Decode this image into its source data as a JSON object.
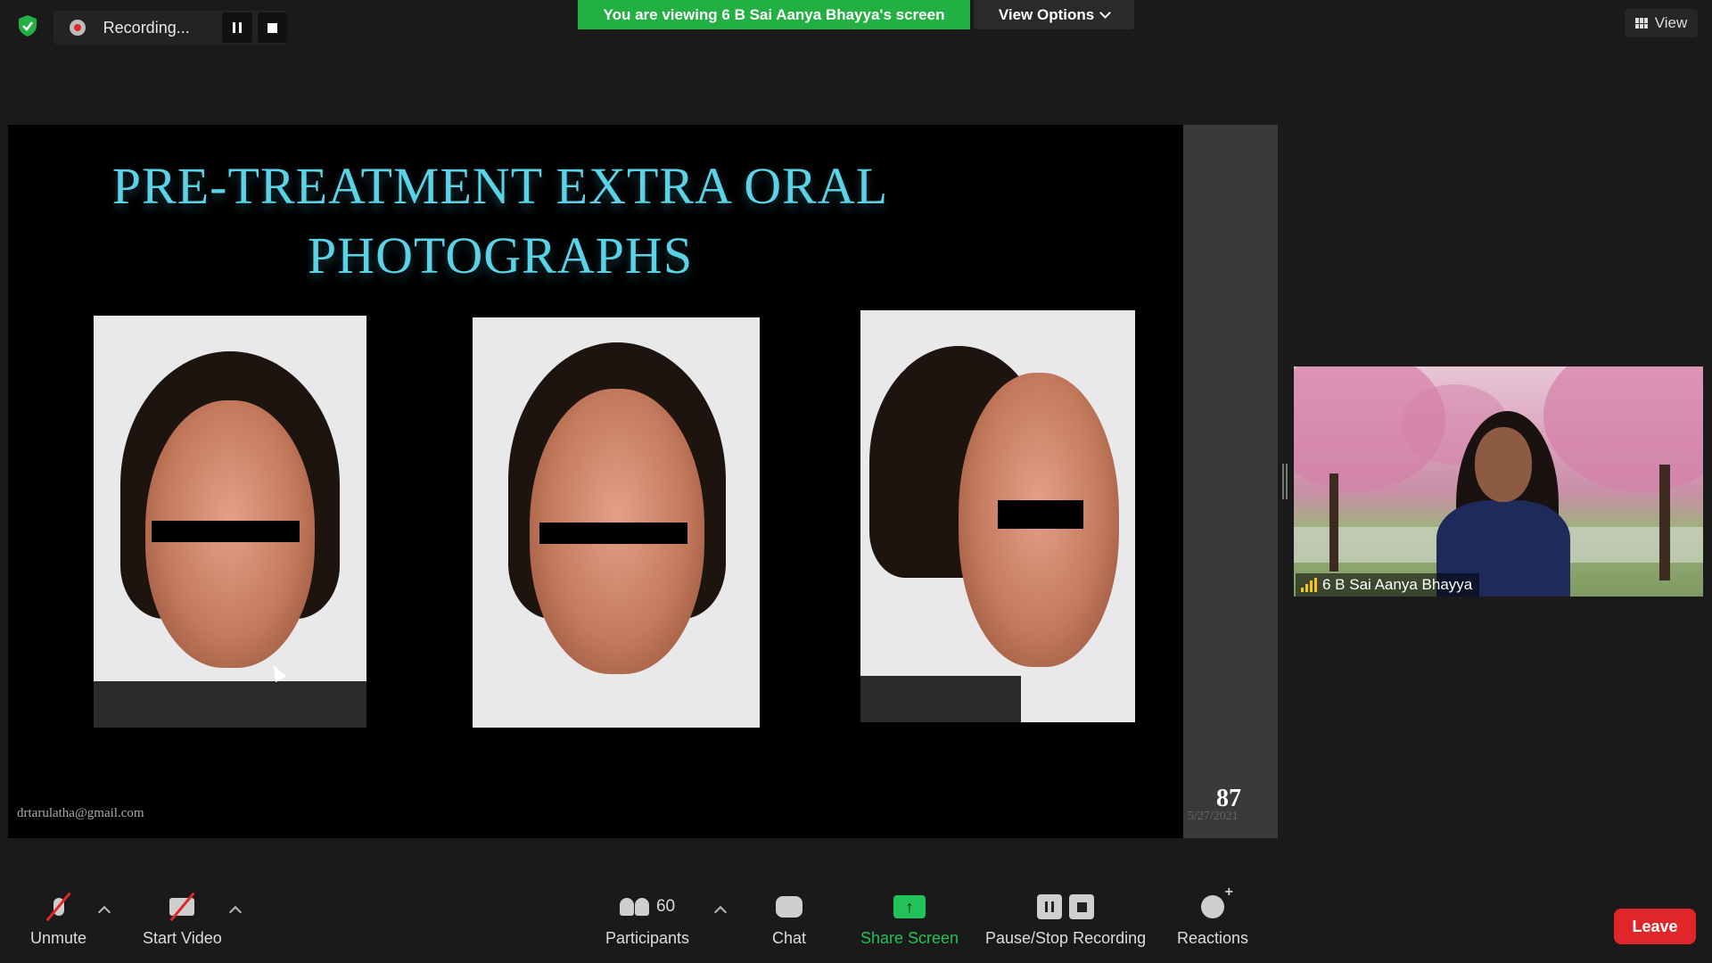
{
  "recording": {
    "label": "Recording..."
  },
  "banner": {
    "text": "You are viewing 6 B Sai Aanya Bhayya's screen"
  },
  "view_options": {
    "label": "View Options"
  },
  "view_button": {
    "label": "View"
  },
  "slide": {
    "title_line1": "PRE-TREATMENT EXTRA ORAL",
    "title_line2": "PHOTOGRAPHS",
    "email": "drtarulatha@gmail.com",
    "number": "87",
    "date": "5/27/2021",
    "title_color": "#5ad3e6"
  },
  "participant": {
    "name": "6 B Sai Aanya Bhayya"
  },
  "toolbar": {
    "unmute": "Unmute",
    "start_video": "Start Video",
    "participants": "Participants",
    "participants_count": "60",
    "chat": "Chat",
    "share_screen": "Share Screen",
    "pause_stop": "Pause/Stop Recording",
    "reactions": "Reactions",
    "leave": "Leave"
  },
  "colors": {
    "banner": "#23b043",
    "share_accent": "#23c15a",
    "leave": "#e0262b"
  }
}
